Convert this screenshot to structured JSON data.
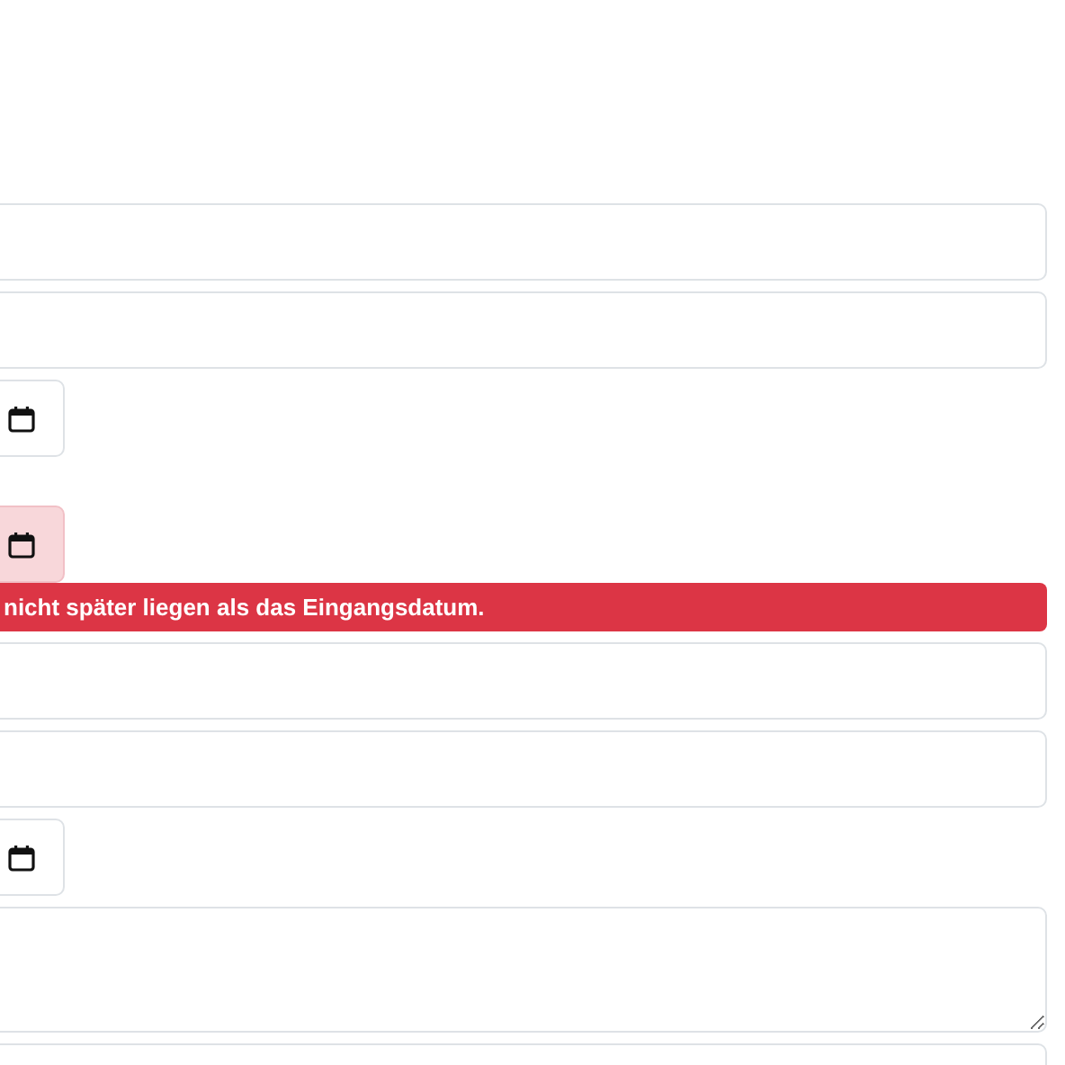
{
  "fields": [
    {
      "kind": "text"
    },
    {
      "kind": "text"
    },
    {
      "kind": "date",
      "invalid": false
    },
    {
      "kind": "date",
      "invalid": true
    },
    {
      "kind": "error",
      "message": "nicht später liegen als das Eingangsdatum."
    },
    {
      "kind": "text"
    },
    {
      "kind": "text"
    },
    {
      "kind": "date",
      "invalid": false
    },
    {
      "kind": "textarea"
    },
    {
      "kind": "text"
    }
  ]
}
